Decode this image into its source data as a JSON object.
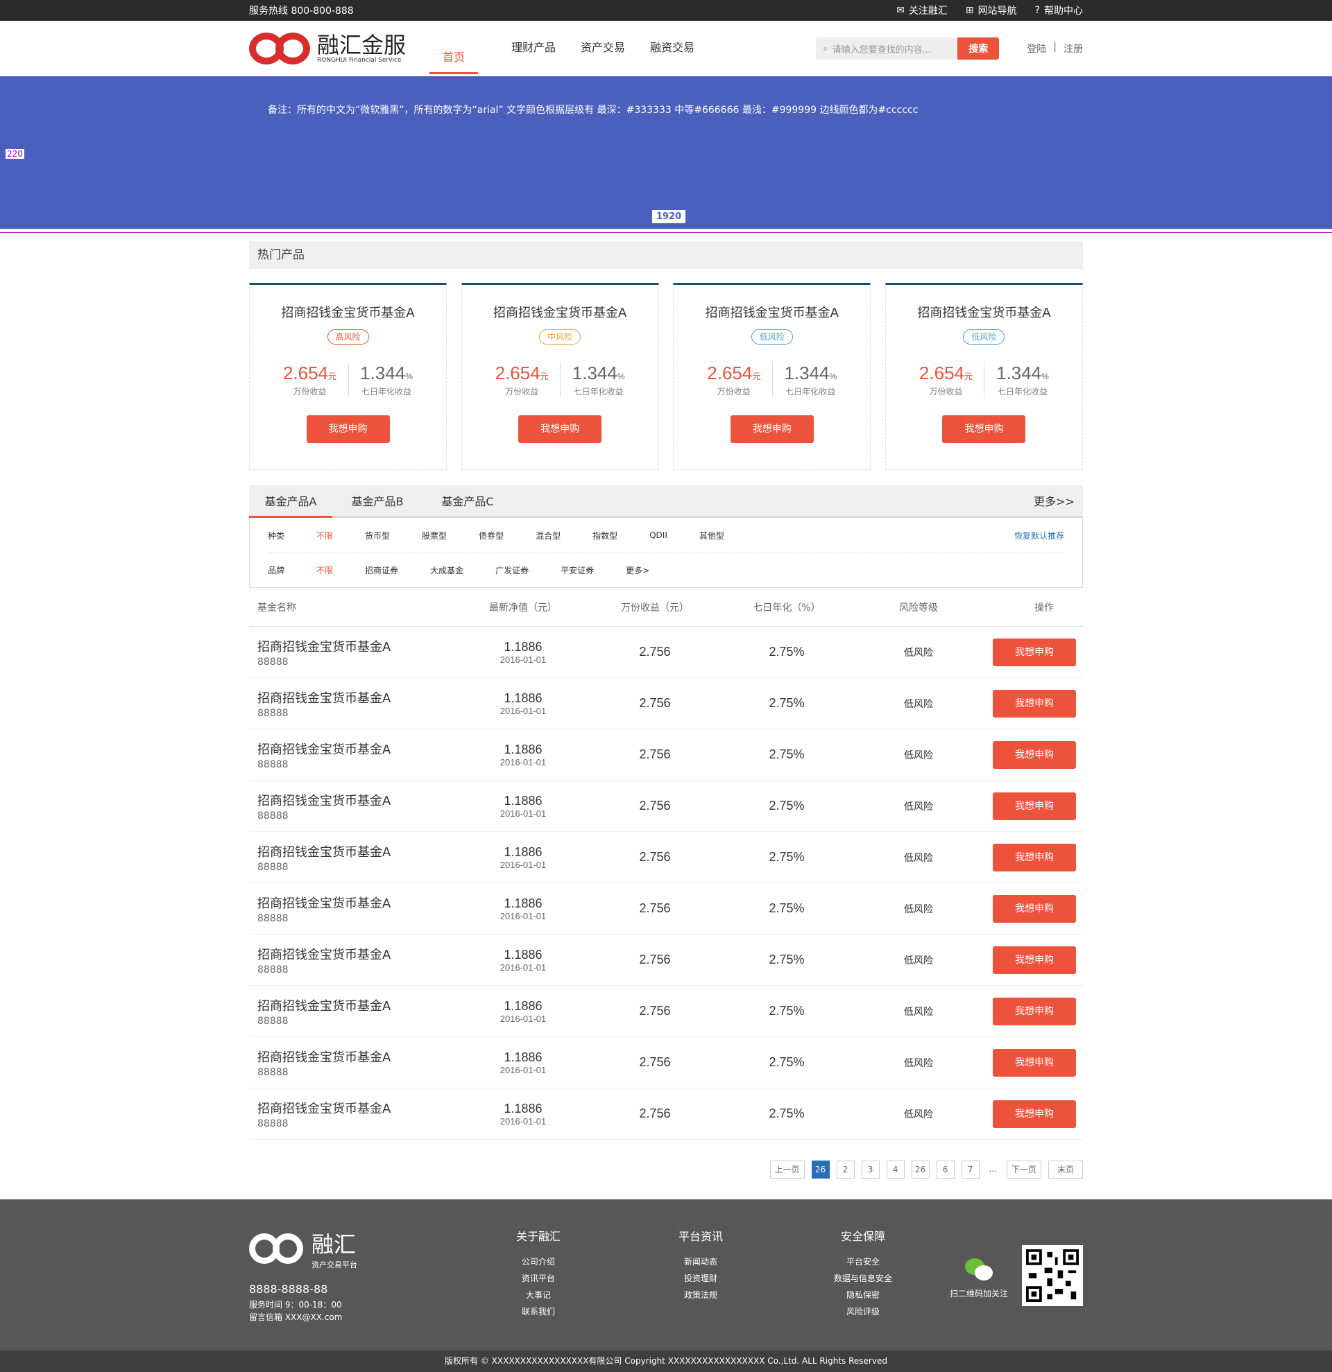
{
  "topbar": {
    "hotline": "服务热线  800-800-888",
    "links": [
      "关注融汇",
      "网站导航",
      "帮助中心"
    ]
  },
  "header": {
    "logo_cn": "融汇金服",
    "logo_en": "RONGHUI Financial Service",
    "nav": [
      "首页",
      "理财产品",
      "资产交易",
      "融资交易"
    ],
    "search_placeholder": "请输入您要查找的内容...",
    "search_button": "搜索",
    "login": "登陆",
    "sep": "|",
    "register": "注册"
  },
  "banner": {
    "note": "备注：所有的中文为“微软雅黑”，所有的数字为“arial” 文字颜色根据层级有 最深：#333333  中等#666666 最浅：#999999 边线颜色都为#cccccc",
    "height_mark": "220",
    "width_mark": "1920"
  },
  "hot": {
    "title": "热门产品",
    "cards": [
      {
        "name": "招商招钱金宝货币基金A",
        "risk": "高风险",
        "risk_color": "#ed533a",
        "yield": "2.654",
        "yield_unit": "元",
        "rate": "1.344",
        "rate_unit": "%",
        "yield_label": "万份收益",
        "rate_label": "七日年化收益",
        "buy": "我想申购"
      },
      {
        "name": "招商招钱金宝货币基金A",
        "risk": "中风险",
        "risk_color": "#ed9f3a",
        "yield": "2.654",
        "yield_unit": "元",
        "rate": "1.344",
        "rate_unit": "%",
        "yield_label": "万份收益",
        "rate_label": "七日年化收益",
        "buy": "我想申购"
      },
      {
        "name": "招商招钱金宝货币基金A",
        "risk": "低风险",
        "risk_color": "#4e9ad7",
        "yield": "2.654",
        "yield_unit": "元",
        "rate": "1.344",
        "rate_unit": "%",
        "yield_label": "万份收益",
        "rate_label": "七日年化收益",
        "buy": "我想申购"
      },
      {
        "name": "招商招钱金宝货币基金A",
        "risk": "低风险",
        "risk_color": "#4e9ad7",
        "yield": "2.654",
        "yield_unit": "元",
        "rate": "1.344",
        "rate_unit": "%",
        "yield_label": "万份收益",
        "rate_label": "七日年化收益",
        "buy": "我想申购"
      }
    ]
  },
  "funds": {
    "tabs": [
      "基金产品A",
      "基金产品B",
      "基金产品C"
    ],
    "more": "更多>>",
    "type_label": "种类",
    "types": [
      "不限",
      "货币型",
      "股票型",
      "债券型",
      "混合型",
      "指数型",
      "QDII",
      "其他型"
    ],
    "reset": "恢复默认推荐",
    "brand_label": "品牌",
    "brands": [
      "不限",
      "招商证券",
      "大成基金",
      "广发证券",
      "平安证券",
      "更多>"
    ],
    "headers": [
      "基金名称",
      "最新净值（元）",
      "万份收益（元）",
      "七日年化（%）",
      "风险等级",
      "操作"
    ],
    "rows": [
      {
        "name": "招商招钱金宝货币基金A",
        "code": "88888",
        "nav": "1.1886",
        "date": "2016-01-01",
        "yield": "2.756",
        "rate": "2.75%",
        "risk": "低风险",
        "buy": "我想申购"
      },
      {
        "name": "招商招钱金宝货币基金A",
        "code": "88888",
        "nav": "1.1886",
        "date": "2016-01-01",
        "yield": "2.756",
        "rate": "2.75%",
        "risk": "低风险",
        "buy": "我想申购"
      },
      {
        "name": "招商招钱金宝货币基金A",
        "code": "88888",
        "nav": "1.1886",
        "date": "2016-01-01",
        "yield": "2.756",
        "rate": "2.75%",
        "risk": "低风险",
        "buy": "我想申购"
      },
      {
        "name": "招商招钱金宝货币基金A",
        "code": "88888",
        "nav": "1.1886",
        "date": "2016-01-01",
        "yield": "2.756",
        "rate": "2.75%",
        "risk": "低风险",
        "buy": "我想申购"
      },
      {
        "name": "招商招钱金宝货币基金A",
        "code": "88888",
        "nav": "1.1886",
        "date": "2016-01-01",
        "yield": "2.756",
        "rate": "2.75%",
        "risk": "低风险",
        "buy": "我想申购"
      },
      {
        "name": "招商招钱金宝货币基金A",
        "code": "88888",
        "nav": "1.1886",
        "date": "2016-01-01",
        "yield": "2.756",
        "rate": "2.75%",
        "risk": "低风险",
        "buy": "我想申购"
      },
      {
        "name": "招商招钱金宝货币基金A",
        "code": "88888",
        "nav": "1.1886",
        "date": "2016-01-01",
        "yield": "2.756",
        "rate": "2.75%",
        "risk": "低风险",
        "buy": "我想申购"
      },
      {
        "name": "招商招钱金宝货币基金A",
        "code": "88888",
        "nav": "1.1886",
        "date": "2016-01-01",
        "yield": "2.756",
        "rate": "2.75%",
        "risk": "低风险",
        "buy": "我想申购"
      },
      {
        "name": "招商招钱金宝货币基金A",
        "code": "88888",
        "nav": "1.1886",
        "date": "2016-01-01",
        "yield": "2.756",
        "rate": "2.75%",
        "risk": "低风险",
        "buy": "我想申购"
      },
      {
        "name": "招商招钱金宝货币基金A",
        "code": "88888",
        "nav": "1.1886",
        "date": "2016-01-01",
        "yield": "2.756",
        "rate": "2.75%",
        "risk": "低风险",
        "buy": "我想申购"
      }
    ]
  },
  "pager": {
    "prev": "上一页",
    "pages": [
      "26",
      "2",
      "3",
      "4",
      "26",
      "6",
      "7"
    ],
    "current": "26",
    "dots": "...",
    "next": "下一页",
    "last": "末页"
  },
  "footer": {
    "logo_cn": "融汇",
    "logo_sub": "资产交易平台",
    "phone": "8888-8888-88",
    "hours": "服务时间    9：00-18：00",
    "mail": "留言信箱    XXX@XX.com",
    "cols": [
      {
        "title": "关于融汇",
        "items": [
          "公司介绍",
          "资讯平台",
          "大事记",
          "联系我们"
        ]
      },
      {
        "title": "平台资讯",
        "items": [
          "新闻动态",
          "投资理财",
          "政策法规"
        ]
      },
      {
        "title": "安全保障",
        "items": [
          "平台安全",
          "数据与信息安全",
          "隐私保密",
          "风险评级"
        ]
      }
    ],
    "wechat": "扫二维码加关注",
    "copyright": "版权所有 © XXXXXXXXXXXXXXXXX有限公司    Copyright XXXXXXXXXXXXXXXXX Co.,Ltd. ALL Rights Reserved"
  }
}
